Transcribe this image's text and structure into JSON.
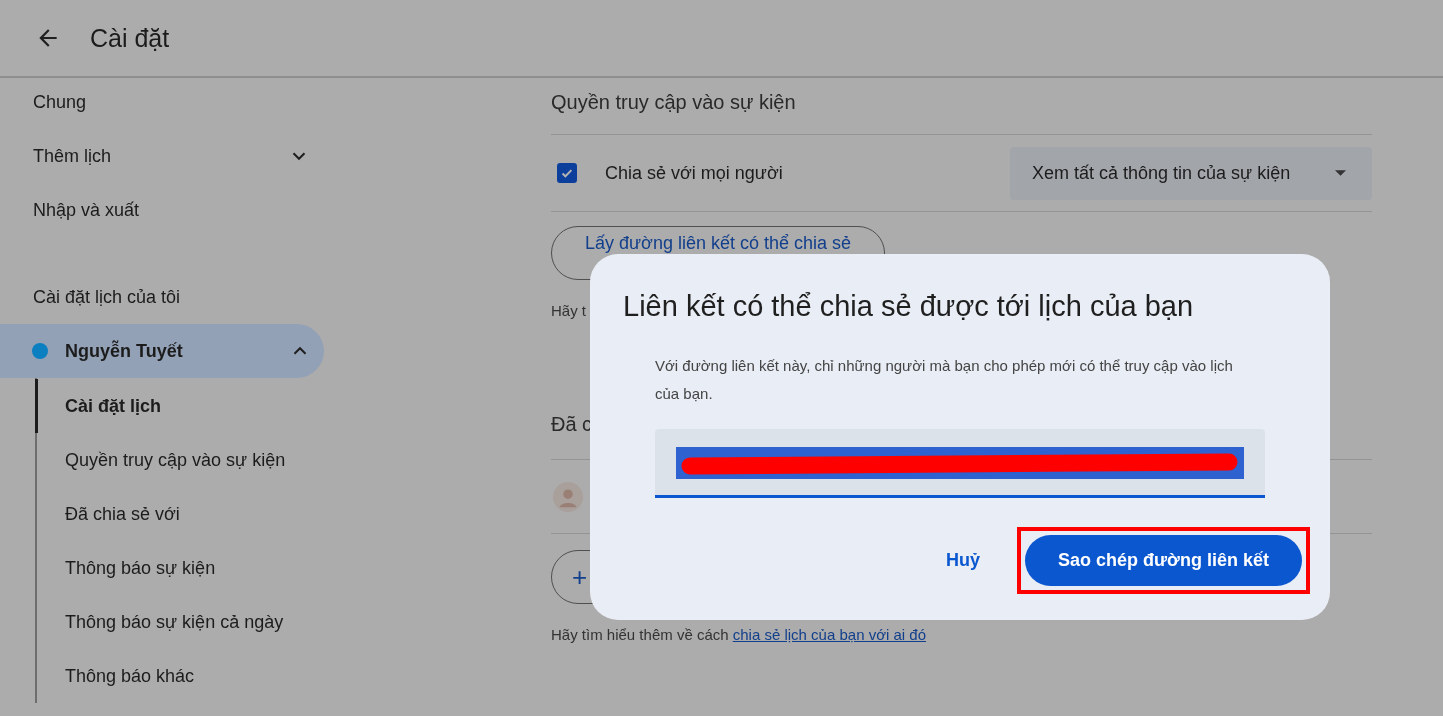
{
  "header": {
    "title": "Cài đặt"
  },
  "sidebar": {
    "items": [
      {
        "label": "Chung",
        "expandable": false
      },
      {
        "label": "Thêm lịch",
        "expandable": true
      },
      {
        "label": "Nhập và xuất",
        "expandable": false
      }
    ],
    "section_title": "Cài đặt lịch của tôi",
    "calendar": {
      "name": "Nguyễn Tuyết",
      "color": "#0b7fc0",
      "expanded": true,
      "selected": true
    },
    "sub_items": [
      {
        "label": "Cài đặt lịch",
        "selected": true
      },
      {
        "label": "Quyền truy cập vào sự kiện",
        "selected": false
      },
      {
        "label": "Đã chia sẻ với",
        "selected": false
      },
      {
        "label": "Thông báo sự kiện",
        "selected": false
      },
      {
        "label": "Thông báo sự kiện cả ngày",
        "selected": false
      },
      {
        "label": "Thông báo khác",
        "selected": false
      }
    ]
  },
  "main": {
    "access_title": "Quyền truy cập vào sự kiện",
    "share": {
      "label": "Chia sẻ với mọi người",
      "checked": true
    },
    "dropdown": {
      "value": "Xem tất cả thông tin của sự kiện"
    },
    "link_button": "Lấy đường liên kết có thể chia sẻ",
    "access_help": "Hãy t",
    "shared_title": "Đã c",
    "add_button": "+",
    "help_text": "Hãy tìm hiểu thêm về cách",
    "help_link": "chia sẻ lịch của bạn với ai đó"
  },
  "dialog": {
    "title": "Liên kết có thể chia sẻ được tới lịch của bạn",
    "body": "Với đường liên kết này, chỉ những người mà bạn cho phép mới có thể truy cập vào lịch của bạn.",
    "link_field": {
      "redacted": true
    },
    "cancel": "Huỷ",
    "copy": "Sao chép đường liên kết",
    "highlighted": true
  }
}
